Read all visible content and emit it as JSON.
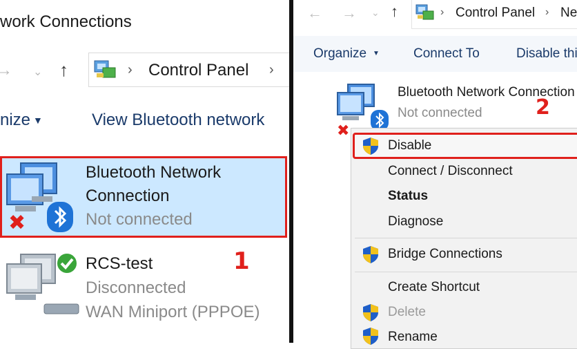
{
  "left": {
    "window_title": "work Connections",
    "address": {
      "path": "Control Panel"
    },
    "toolbar": {
      "organize": "nize",
      "view_bluetooth": "View Bluetooth network"
    },
    "items": [
      {
        "name_line1": "Bluetooth Network",
        "name_line2": "Connection",
        "status": "Not connected"
      },
      {
        "name_line1": "RCS-test",
        "status": "Disconnected",
        "device": "WAN Miniport (PPPOE)"
      }
    ],
    "step_label": "1"
  },
  "right": {
    "address": {
      "path": "Control Panel",
      "next": "Ne"
    },
    "toolbar": {
      "organize": "Organize",
      "connect_to": "Connect To",
      "disable": "Disable thi"
    },
    "item": {
      "name": "Bluetooth Network Connection",
      "status": "Not connected"
    },
    "step_label": "2",
    "context_menu": [
      {
        "label": "Disable",
        "shield": true,
        "selected": true
      },
      {
        "label": "Connect / Disconnect"
      },
      {
        "label": "Status",
        "bold": true
      },
      {
        "label": "Diagnose"
      },
      {
        "label": "Bridge Connections",
        "shield": true
      },
      {
        "label": "Create Shortcut"
      },
      {
        "label": "Delete",
        "shield": true,
        "disabled": true
      },
      {
        "label": "Rename",
        "shield": true
      }
    ]
  },
  "colors": {
    "highlight_red": "#e0201c",
    "selection_blue": "#cce8ff",
    "link_blue": "#1a3a6a",
    "bluetooth_blue": "#1f73d6"
  }
}
